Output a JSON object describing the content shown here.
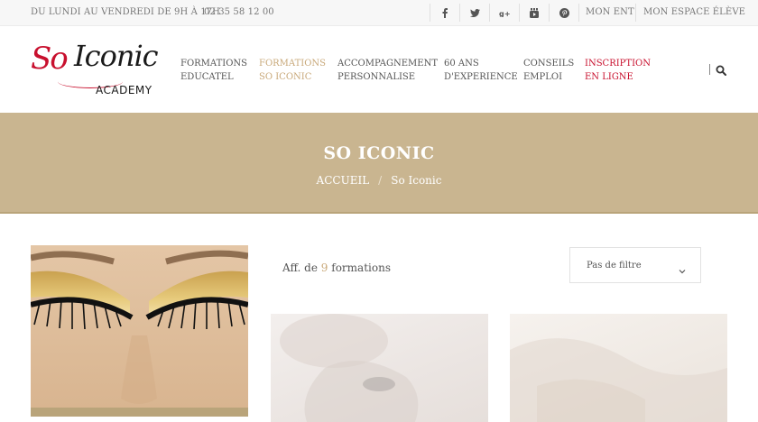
{
  "topbar": {
    "hours": "DU LUNDI AU VENDREDI DE 9H À 17H",
    "phone": "02 35 58 12 00",
    "social": [
      "facebook-icon",
      "twitter-icon",
      "google-plus-icon",
      "youtube-icon",
      "pinterest-icon"
    ],
    "links": [
      "MON ENT",
      "MON ESPACE ÉLÈVE"
    ]
  },
  "logo": {
    "so": "So",
    "iconic": "Iconic",
    "academy": "ACADEMY"
  },
  "nav": [
    {
      "line1": "FORMATIONS",
      "line2": "EDUCATEL"
    },
    {
      "line1": "FORMATIONS",
      "line2": "SO ICONIC"
    },
    {
      "line1": "ACCOMPAGNEMENT",
      "line2": "PERSONNALISE"
    },
    {
      "line1": "60 ANS",
      "line2": "D'EXPERIENCE"
    },
    {
      "line1": "CONSEILS",
      "line2": "EMPLOI"
    },
    {
      "line1": "INSCRIPTION",
      "line2": "EN LIGNE"
    }
  ],
  "banner": {
    "title": "SO ICONIC",
    "breadcrumb_home": "ACCUEIL",
    "breadcrumb_sep": "/",
    "breadcrumb_current": "So Iconic"
  },
  "results": {
    "prefix": "Aff. de",
    "count": "9",
    "suffix": "formations"
  },
  "filter": {
    "selected": "Pas de filtre"
  },
  "colors": {
    "accent": "#c9a97a",
    "banner": "#c9b590",
    "brand_red": "#c8102e"
  }
}
